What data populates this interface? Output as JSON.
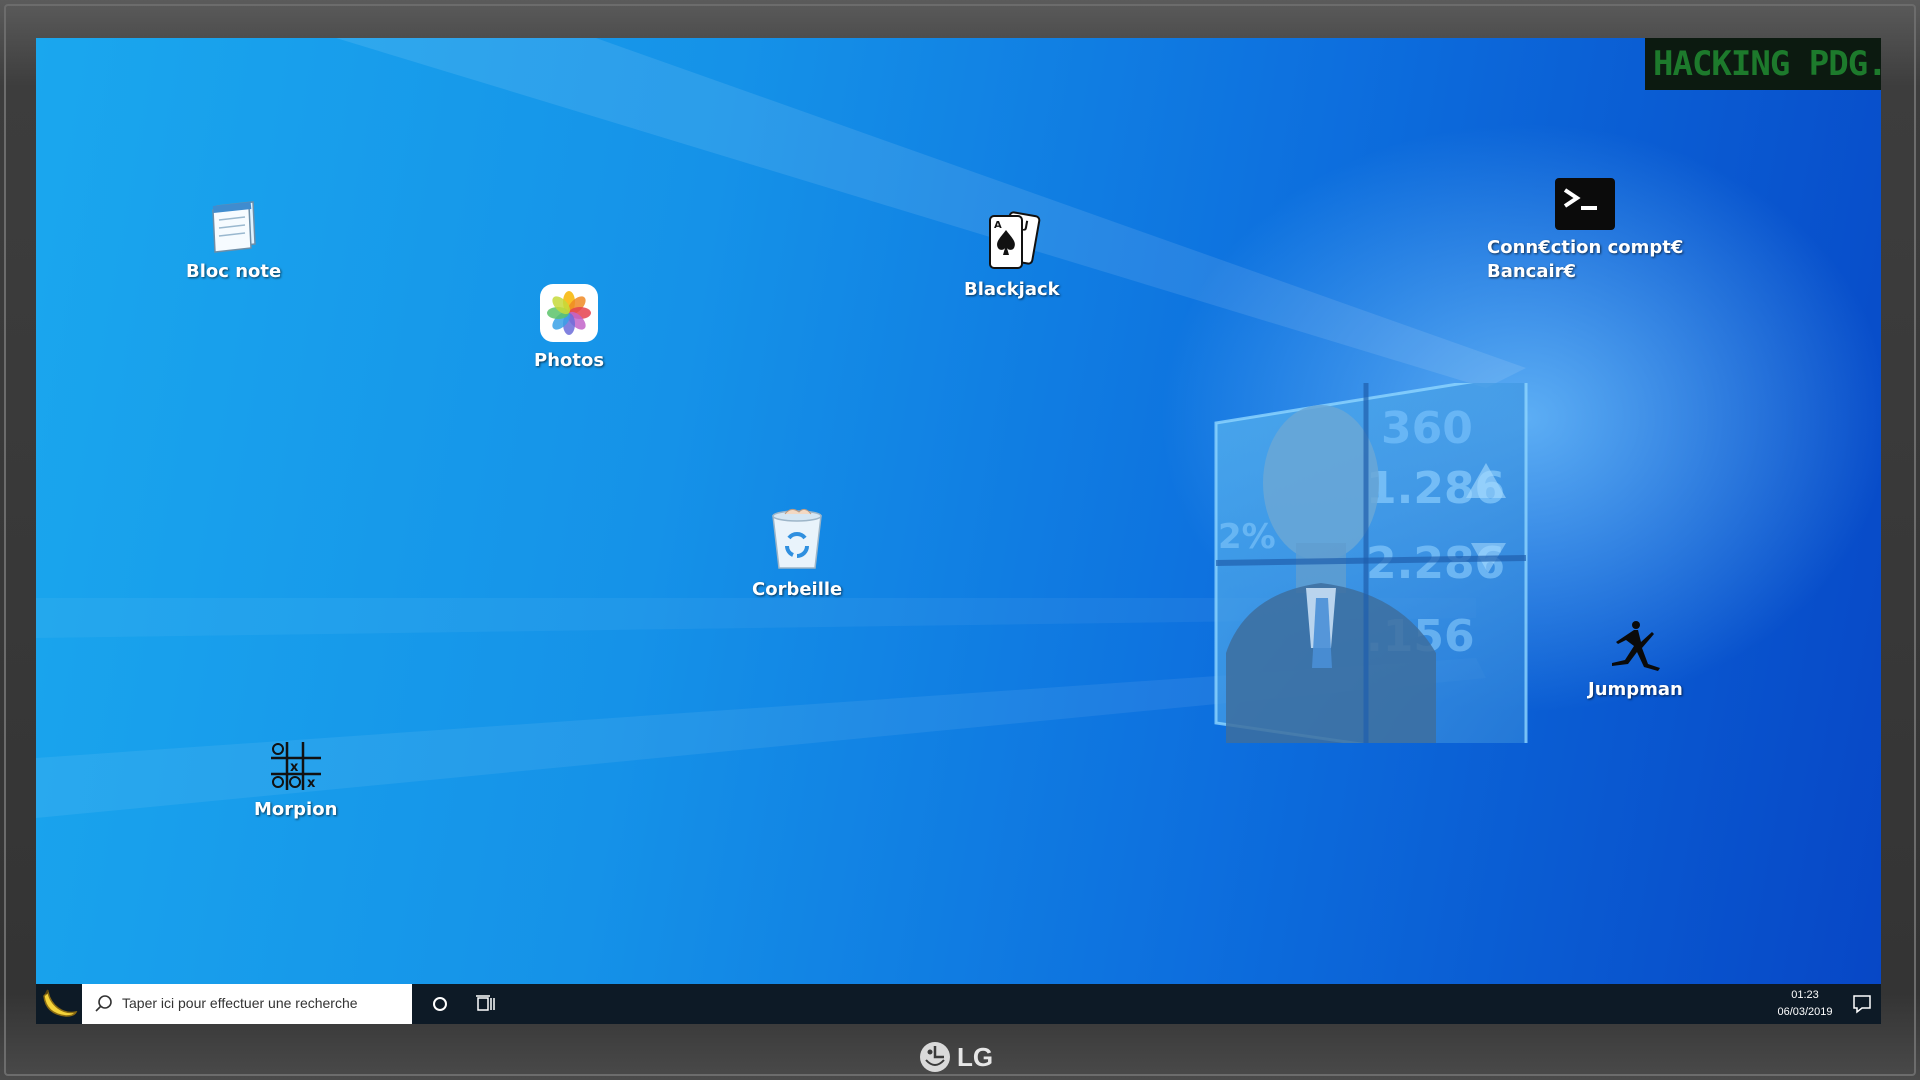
{
  "banner": {
    "text": "HACKING PDG..."
  },
  "desktop": {
    "icons": [
      {
        "label": "Bloc note",
        "icon": "notepad-icon"
      },
      {
        "label": "Photos",
        "icon": "photos-icon"
      },
      {
        "label": "Blackjack",
        "icon": "playing-cards-icon"
      },
      {
        "label": "Conn€ction compt€",
        "label_line2": "Bancair€",
        "icon": "terminal-icon"
      },
      {
        "label": "Corbeille",
        "icon": "recycle-bin-icon"
      },
      {
        "label": "Jumpman",
        "icon": "jumpman-icon"
      },
      {
        "label": "Morpion",
        "icon": "tic-tac-toe-icon"
      }
    ]
  },
  "taskbar": {
    "start_icon": "banana-icon",
    "search_placeholder": "Taper ici pour effectuer une recherche",
    "time": "01:23",
    "date": "06/03/2019"
  },
  "monitor": {
    "brand": "LG"
  },
  "colors": {
    "desktop_blue": "#1592e8",
    "taskbar": "#0d1a26",
    "banner_bg": "#0c1a10",
    "banner_text": "#1d7a2c"
  }
}
